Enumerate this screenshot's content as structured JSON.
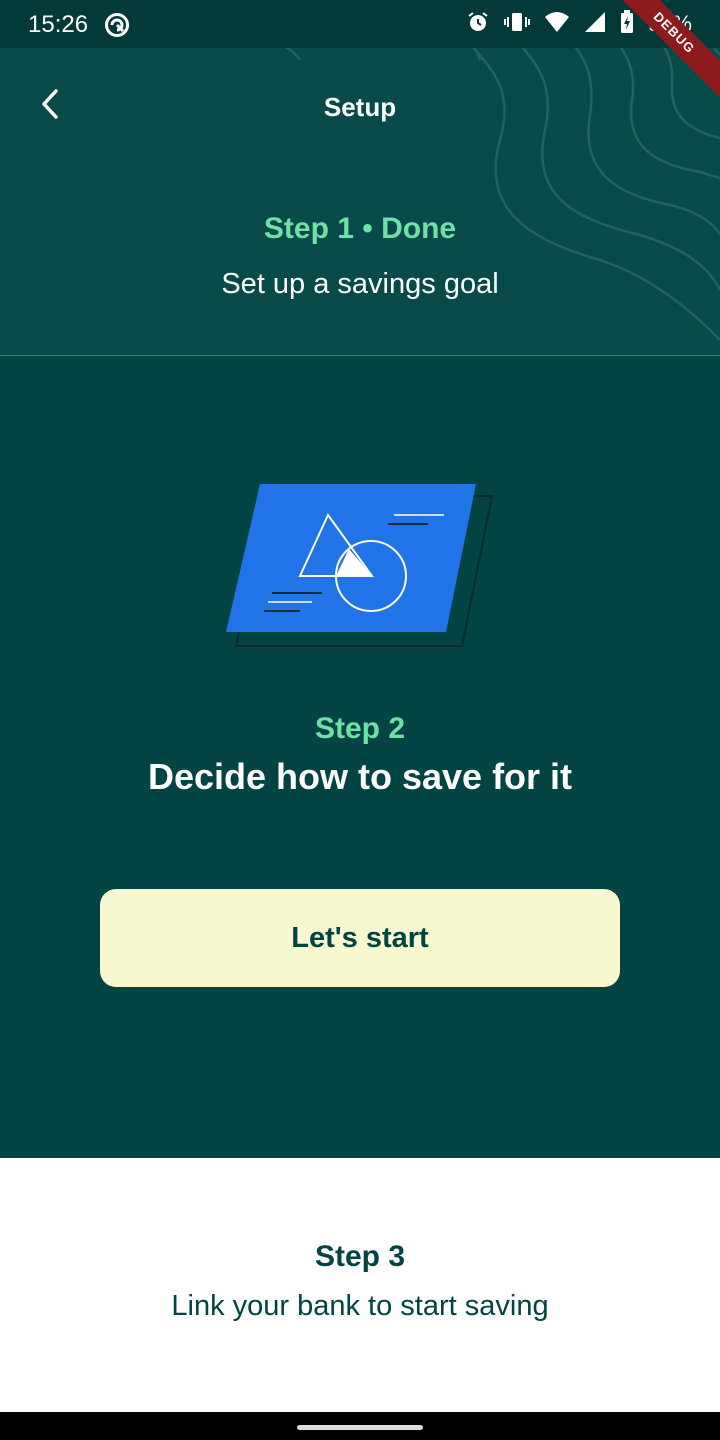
{
  "status_bar": {
    "time": "15:26",
    "battery": "92%",
    "icons": [
      "app-notification-icon",
      "alarm-icon",
      "vibrate-icon",
      "wifi-icon",
      "signal-icon",
      "battery-charging-icon"
    ]
  },
  "debug_banner": "DEBUG",
  "app_bar": {
    "title": "Setup",
    "back_icon": "chevron-left-icon"
  },
  "step1": {
    "status": "Step 1 • Done",
    "description": "Set up a savings goal"
  },
  "step2": {
    "label": "Step 2",
    "title": "Decide how to save for it",
    "button_label": "Let's start",
    "illustration": "document-with-shapes-illustration"
  },
  "step3": {
    "label": "Step 3",
    "description": "Link your bank to start saving"
  },
  "colors": {
    "background": "#014443",
    "header_background": "#074a49",
    "accent_green": "#6fe0a6",
    "button_background": "#f7f7d0",
    "illustration_blue": "#2173e8",
    "card_background": "#ffffff"
  }
}
